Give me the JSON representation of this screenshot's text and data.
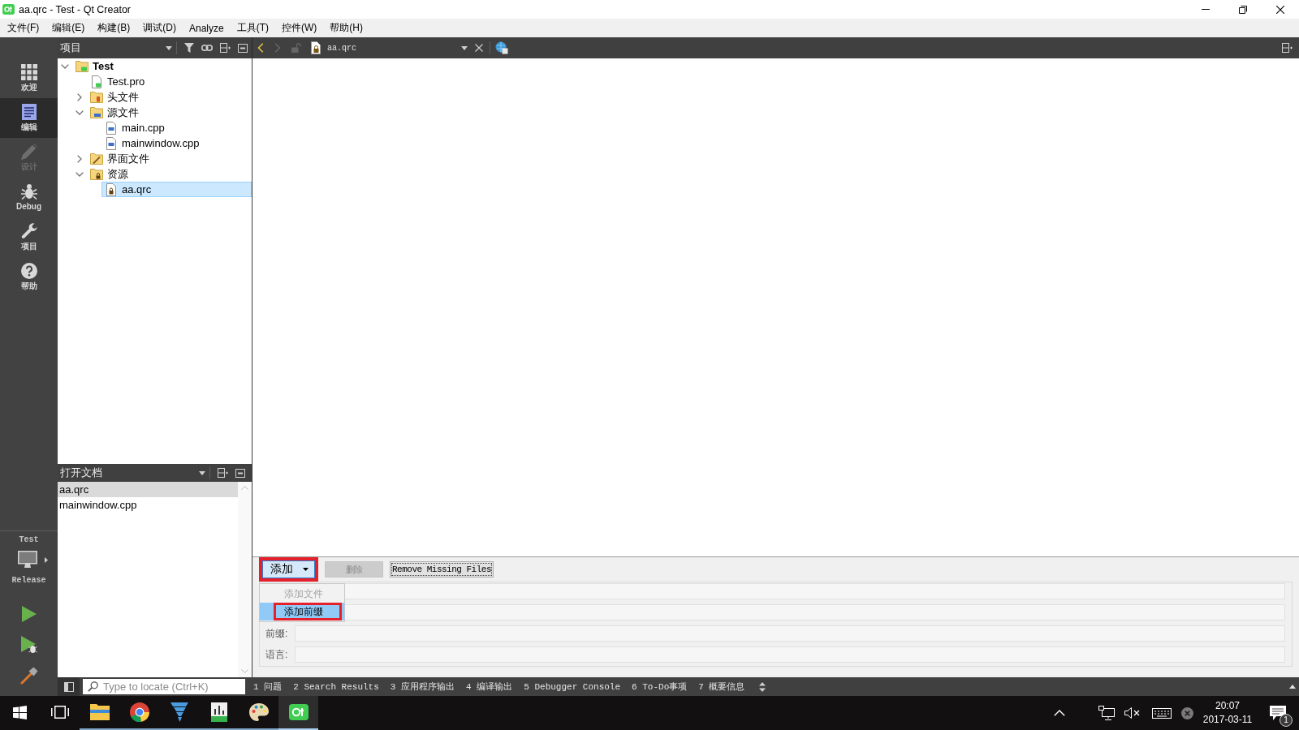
{
  "window": {
    "title": "aa.qrc - Test - Qt Creator"
  },
  "menu_bar": [
    "文件(F)",
    "编辑(E)",
    "构建(B)",
    "调试(D)",
    "Analyze",
    "工具(T)",
    "控件(W)",
    "帮助(H)"
  ],
  "mode_bar": {
    "modes": [
      {
        "kind": "welcome",
        "label": "欢迎",
        "selected": false,
        "disabled": false
      },
      {
        "kind": "edit",
        "label": "编辑",
        "selected": true,
        "disabled": false
      },
      {
        "kind": "design",
        "label": "设计",
        "selected": false,
        "disabled": true
      },
      {
        "kind": "debug",
        "label": "Debug",
        "selected": false,
        "disabled": false
      },
      {
        "kind": "projects",
        "label": "项目",
        "selected": false,
        "disabled": false
      },
      {
        "kind": "help",
        "label": "帮助",
        "selected": false,
        "disabled": false
      }
    ],
    "kit": {
      "project": "Test",
      "build": "Release"
    }
  },
  "project_pane": {
    "title": "项目",
    "tree": [
      {
        "label": "Test",
        "kind": "project",
        "expanded": true,
        "selected": false,
        "children": [
          {
            "label": "Test.pro",
            "kind": "pro-file",
            "selected": false
          },
          {
            "label": "头文件",
            "kind": "header-folder",
            "expanded": false,
            "selected": false
          },
          {
            "label": "源文件",
            "kind": "source-folder",
            "expanded": true,
            "selected": false,
            "children": [
              {
                "label": "main.cpp",
                "kind": "cpp-file",
                "selected": false
              },
              {
                "label": "mainwindow.cpp",
                "kind": "cpp-file",
                "selected": false
              }
            ]
          },
          {
            "label": "界面文件",
            "kind": "form-folder",
            "expanded": false,
            "selected": false
          },
          {
            "label": "资源",
            "kind": "resource-folder",
            "expanded": true,
            "selected": false,
            "children": [
              {
                "label": "aa.qrc",
                "kind": "qrc-file",
                "selected": true
              }
            ]
          }
        ]
      }
    ]
  },
  "open_documents": {
    "title": "打开文档",
    "items": [
      {
        "label": "aa.qrc",
        "selected": true
      },
      {
        "label": "mainwindow.cpp",
        "selected": false
      }
    ]
  },
  "editor_toolbar": {
    "navigation": [
      {
        "kind": "back",
        "disabled": false
      },
      {
        "kind": "forward",
        "disabled": true
      }
    ],
    "document": "aa.qrc"
  },
  "resource_editor": {
    "buttons": [
      {
        "kind": "dropdown",
        "label": "添加",
        "disabled": false,
        "highlighted": true
      },
      {
        "kind": "plain",
        "label": "删除",
        "disabled": true,
        "highlighted": false
      },
      {
        "kind": "plain",
        "label": "Remove Missing Files",
        "disabled": false,
        "highlighted": false
      }
    ],
    "menu": [
      {
        "label": "添加文件",
        "disabled": true,
        "selected": false,
        "highlighted": false
      },
      {
        "label": "添加前缀",
        "disabled": false,
        "selected": true,
        "highlighted": true
      }
    ],
    "fields": [
      {
        "kind": "unlabeled"
      },
      {
        "kind": "unlabeled"
      },
      {
        "kind": "labeled",
        "label": "前缀:"
      },
      {
        "kind": "labeled",
        "label": "语言:"
      }
    ]
  },
  "output_bar": {
    "locator": {
      "placeholder": "Type to locate (Ctrl+K)"
    },
    "tabs": [
      "1 问题",
      "2 Search Results",
      "3 应用程序输出",
      "4 编译输出",
      "5 Debugger Console",
      "6 To-Do事项",
      "7 概要信息"
    ]
  },
  "taskbar": {
    "apps": [
      {
        "kind": "start",
        "running": false,
        "active": false
      },
      {
        "kind": "task-view",
        "running": false,
        "active": false
      },
      {
        "kind": "folder",
        "running": true,
        "active": false
      },
      {
        "kind": "browser",
        "running": true,
        "active": false
      },
      {
        "kind": "tornado",
        "running": true,
        "active": false
      },
      {
        "kind": "chart",
        "running": true,
        "active": false
      },
      {
        "kind": "palette",
        "running": true,
        "active": false
      },
      {
        "kind": "app",
        "running": true,
        "active": true
      }
    ],
    "tray": {
      "volume_muted": true,
      "time": "20:07",
      "date": "2017-03-11",
      "notification_count": "1"
    }
  }
}
